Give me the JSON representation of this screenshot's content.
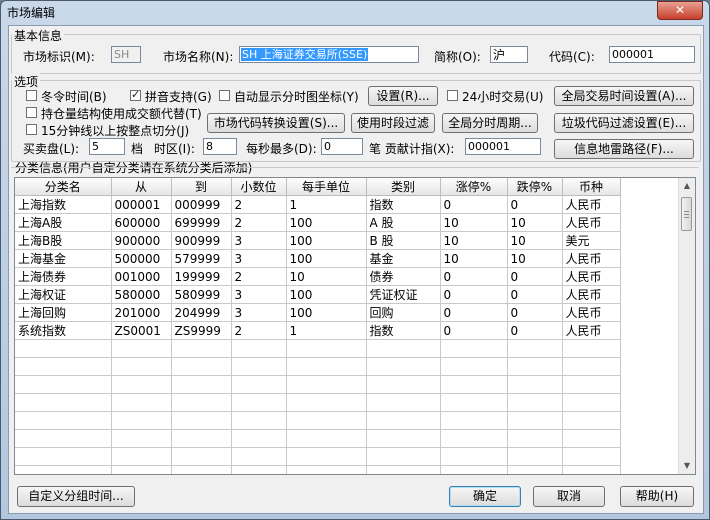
{
  "window": {
    "title": "市场编辑",
    "close_glyph": "✕"
  },
  "basic": {
    "legend": "基本信息",
    "market_id_label": "市场标识(M):",
    "market_id_value": "SH",
    "market_name_label": "市场名称(N):",
    "market_name_value": "SH 上海证券交易所(SSE)",
    "short_label": "简称(O):",
    "short_value": "沪",
    "code_label": "代码(C):",
    "code_value": "000001"
  },
  "options": {
    "legend": "选项",
    "winter_time": {
      "label": "冬令时间(B)",
      "checked": false
    },
    "pinyin": {
      "label": "拼音支持(G)",
      "checked": true
    },
    "auto_show": {
      "label": "自动显示分时图坐标(Y)",
      "checked": false
    },
    "settings_btn": "设置(R)...",
    "h24": {
      "label": "24小时交易(U)",
      "checked": false
    },
    "global_time_btn": "全局交易时间设置(A)...",
    "holding": {
      "label": "持仓量结构使用成交额代替(T)",
      "checked": false
    },
    "min15": {
      "label": "15分钟线以上按整点切分(J)",
      "checked": false
    },
    "code_convert_btn": "市场代码转换设置(S)...",
    "period_filter_btn": "使用时段过滤",
    "global_period_btn": "全局分时周期...",
    "garbage_filter_btn": "垃圾代码过滤设置(E)...",
    "bid_label": "买卖盘(L):",
    "bid_value": "5",
    "level_label": "档",
    "tz_label": "时区(I):",
    "tz_value": "8",
    "persec_label": "每秒最多(D):",
    "persec_value": "0",
    "contrib_label": "笔 贡献计指(X):",
    "contrib_value": "000001",
    "mine_path_btn": "信息地雷路径(F)..."
  },
  "classify": {
    "legend": "分类信息(用户自定分类请在系统分类后添加)",
    "columns": [
      "分类名",
      "从",
      "到",
      "小数位",
      "每手单位",
      "类别",
      "涨停%",
      "跌停%",
      "币种"
    ],
    "rows": [
      [
        "上海指数",
        "000001",
        "000999",
        "2",
        "1",
        "指数",
        "0",
        "0",
        "人民币"
      ],
      [
        "上海A股",
        "600000",
        "699999",
        "2",
        "100",
        "A 股",
        "10",
        "10",
        "人民币"
      ],
      [
        "上海B股",
        "900000",
        "900999",
        "3",
        "100",
        "B 股",
        "10",
        "10",
        "美元"
      ],
      [
        "上海基金",
        "500000",
        "579999",
        "3",
        "100",
        "基金",
        "10",
        "10",
        "人民币"
      ],
      [
        "上海债券",
        "001000",
        "199999",
        "2",
        "10",
        "债券",
        "0",
        "0",
        "人民币"
      ],
      [
        "上海权证",
        "580000",
        "580999",
        "3",
        "100",
        "凭证权证",
        "0",
        "0",
        "人民币"
      ],
      [
        "上海回购",
        "201000",
        "204999",
        "3",
        "100",
        "回购",
        "0",
        "0",
        "人民币"
      ],
      [
        "系统指数",
        "ZS0001",
        "ZS9999",
        "2",
        "1",
        "指数",
        "0",
        "0",
        "人民币"
      ]
    ]
  },
  "footer": {
    "custom_group_btn": "自定义分组时间...",
    "ok_btn": "确定",
    "cancel_btn": "取消",
    "help_btn": "帮助(H)"
  }
}
